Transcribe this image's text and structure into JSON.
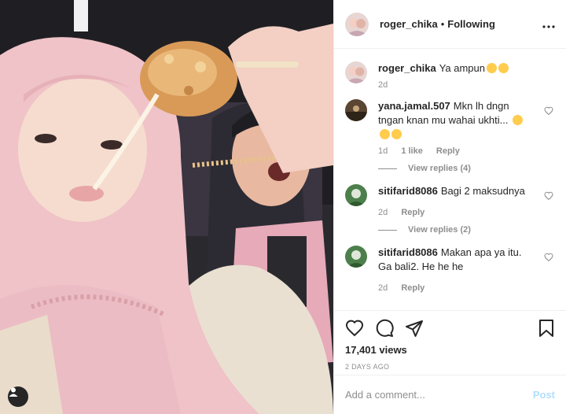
{
  "post": {
    "username": "roger_chika",
    "separator": "•",
    "follow_status": "Following",
    "more_icon": "ellipsis-icon"
  },
  "caption": {
    "username": "roger_chika",
    "text": "Ya ampun",
    "time": "2d"
  },
  "comments": [
    {
      "username": "yana.jamal.507",
      "text": "Mkn lh dngn tngan knan mu wahai ukhti...",
      "time": "1d",
      "likes": "1 like",
      "reply_label": "Reply",
      "view_replies": "View replies (4)"
    },
    {
      "username": "sitifarid8086",
      "text": "Bagi 2 maksudnya",
      "time": "2d",
      "reply_label": "Reply",
      "view_replies": "View replies (2)"
    },
    {
      "username": "sitifarid8086",
      "text": "Makan apa ya itu. Ga bali2. He he he",
      "time": "2d",
      "reply_label": "Reply"
    }
  ],
  "stats": {
    "views": "17,401 views",
    "date": "2 DAYS AGO"
  },
  "composer": {
    "placeholder": "Add a comment...",
    "post_label": "Post"
  },
  "colors": {
    "accent": "#b2dffc",
    "muted": "#8e8e8e",
    "text": "#262626"
  }
}
